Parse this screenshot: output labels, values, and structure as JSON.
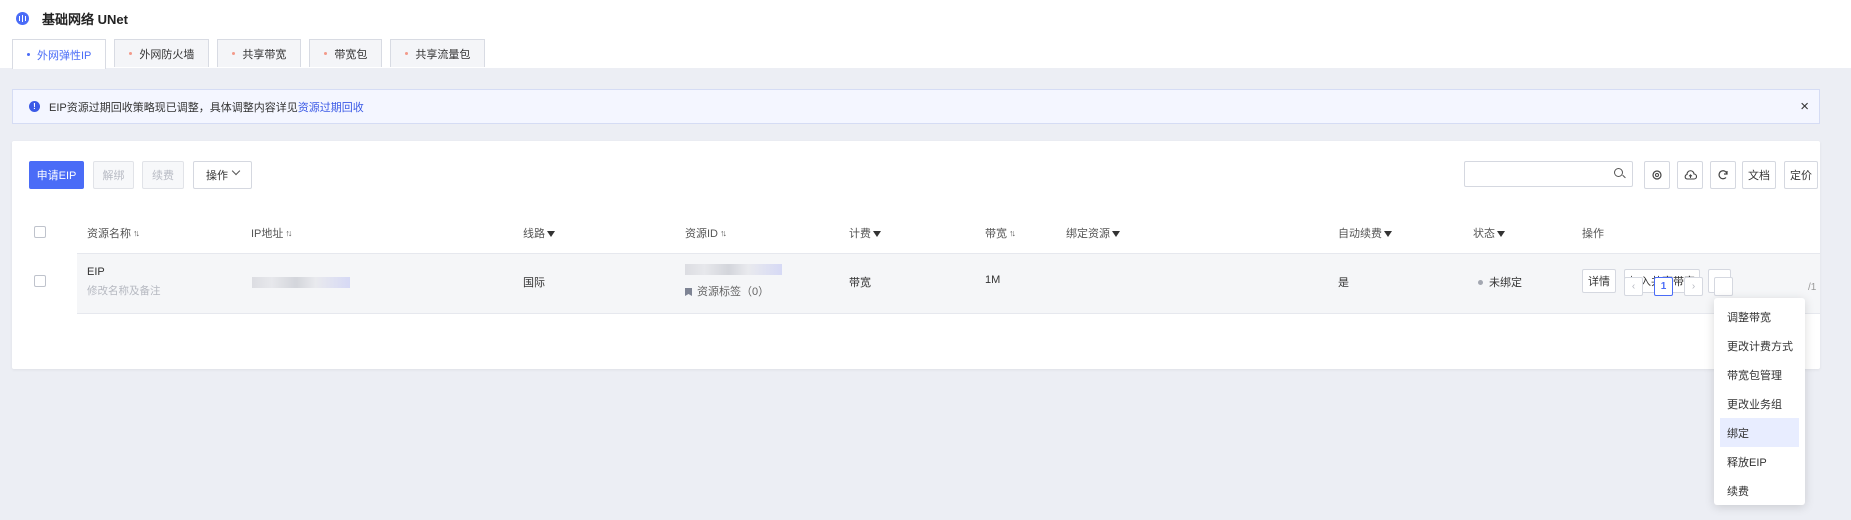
{
  "app": {
    "title": "基础网络 UNet"
  },
  "tabs": [
    {
      "label": "外网弹性IP",
      "active": true
    },
    {
      "label": "外网防火墙",
      "active": false
    },
    {
      "label": "共享带宽",
      "active": false
    },
    {
      "label": "带宽包",
      "active": false
    },
    {
      "label": "共享流量包",
      "active": false
    }
  ],
  "notice": {
    "text": "EIP资源过期回收策略现已调整，具体调整内容详见",
    "link": "资源过期回收",
    "close": "×"
  },
  "toolbar": {
    "apply": "申请EIP",
    "unbind": "解绑",
    "renew": "续费",
    "operation": "操作",
    "search_placeholder": "",
    "docs": "文档",
    "pricing": "定价"
  },
  "table": {
    "headers": {
      "name": "资源名称",
      "ip": "IP地址",
      "line": "线路",
      "resource_id": "资源ID",
      "billing": "计费",
      "bandwidth": "带宽",
      "bound_resource": "绑定资源",
      "auto_renew": "自动续费",
      "status": "状态",
      "actions": "操作"
    },
    "rows": [
      {
        "name": "EIP",
        "remark": "修改名称及备注",
        "line": "国际",
        "tag": "资源标签（0）",
        "billing": "带宽",
        "bandwidth": "1M",
        "auto_renew": "是",
        "status": "未绑定",
        "detail_btn": "详情",
        "join_btn": "加入共享带宽",
        "more_btn": "···"
      }
    ]
  },
  "pagination": {
    "prev": "‹",
    "current": "1",
    "next": "›",
    "total": "/1"
  },
  "more_menu": {
    "items": [
      "调整带宽",
      "更改计费方式",
      "带宽包管理",
      "更改业务组",
      "绑定",
      "释放EIP",
      "续费"
    ],
    "highlighted_index": 4
  },
  "colors": {
    "accent": "#4a6cf7",
    "page_bg": "#eceef4"
  }
}
